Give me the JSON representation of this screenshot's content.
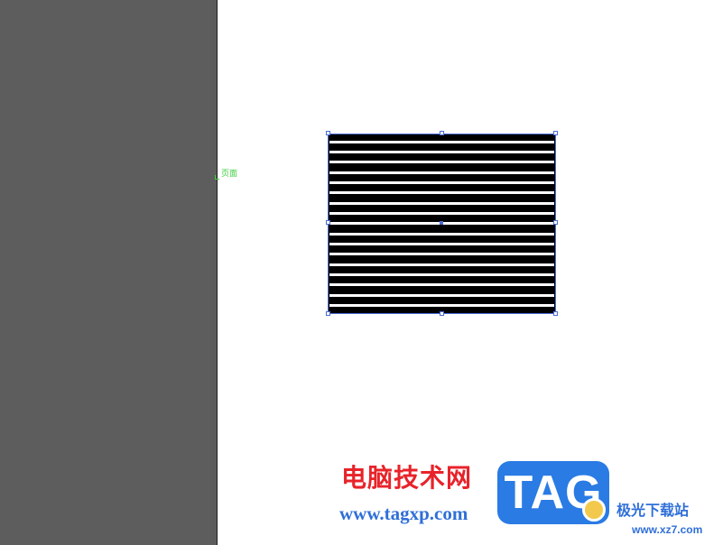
{
  "colors": {
    "pasteboard": "#5d5d5d",
    "page_background": "#ffffff",
    "selection_blue": "#4a6bd6",
    "page_label_green": "#3ccc3c",
    "object_fill": "#000000",
    "stripe_fill": "#ffffff",
    "watermark_red": "#e8232a",
    "watermark_blue": "#2f6fd8",
    "tag_box_blue": "#2a7be4"
  },
  "canvas": {
    "page_label": "页面"
  },
  "selected_object": {
    "stripe_count": 17
  },
  "watermark": {
    "site_name_cn": "电脑技术网",
    "site_url": "www.tagxp.com",
    "tag_text": "TAG",
    "partner_name_cn": "极光下载站",
    "partner_url": "www.xz7.com"
  }
}
